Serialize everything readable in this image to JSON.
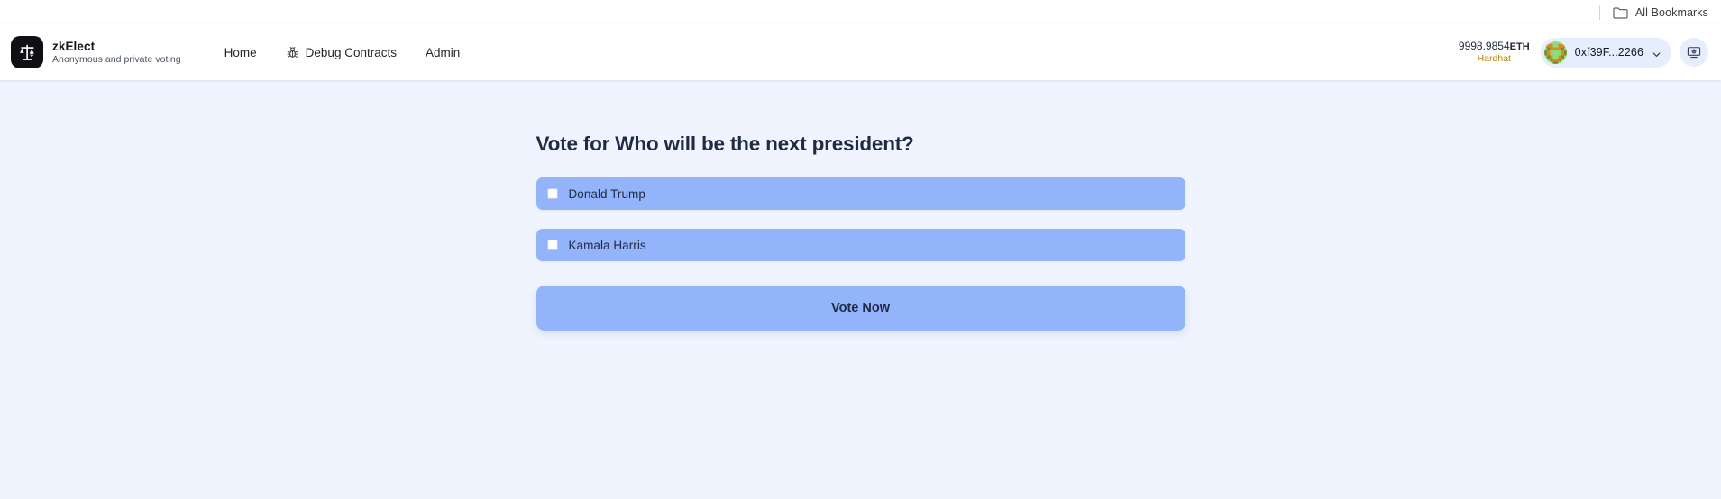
{
  "browser": {
    "bookmarks_label": "All Bookmarks",
    "folder_icon": "folder-icon"
  },
  "header": {
    "brand": {
      "name": "zkElect",
      "tagline": "Anonymous and private voting",
      "logo_icon": "scale-ethereum-icon"
    },
    "nav": [
      {
        "label": "Home",
        "icon": null
      },
      {
        "label": "Debug Contracts",
        "icon": "bug-icon"
      },
      {
        "label": "Admin",
        "icon": null
      }
    ],
    "wallet": {
      "balance_amount": "9998.9854",
      "balance_unit": "ETH",
      "network": "Hardhat",
      "address": "0xf39F...2266",
      "avatar_icon": "blockie-avatar",
      "chevron_icon": "chevron-down-icon",
      "faucet_icon": "faucet-monitor-icon"
    }
  },
  "main": {
    "poll_title": "Vote for Who will be the next president?",
    "options": [
      {
        "label": "Donald Trump",
        "checked": false
      },
      {
        "label": "Kamala Harris",
        "checked": false
      }
    ],
    "vote_button_label": "Vote Now"
  },
  "colors": {
    "page_background": "#eff4ff",
    "accent_blue": "#93b4fa",
    "pill_background": "#e6edfd",
    "network_gold": "#b8860b",
    "title_navy": "#1f2a44"
  }
}
